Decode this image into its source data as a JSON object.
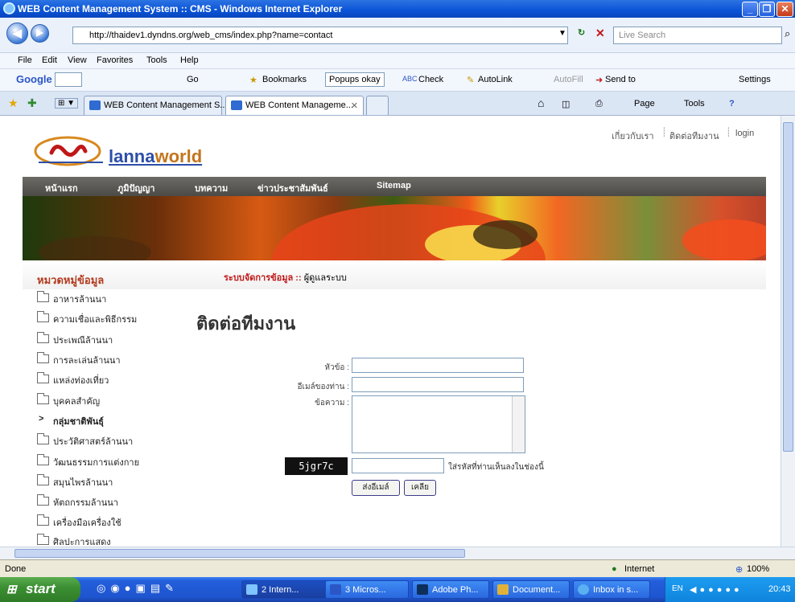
{
  "window": {
    "title": "WEB Content Management System :: CMS - Windows Internet Explorer"
  },
  "browser": {
    "address": "http://thaidev1.dyndns.org/web_cms/index.php?name=contact",
    "search_placeholder": "Live Search",
    "menu": [
      "File",
      "Edit",
      "View",
      "Favorites",
      "Tools",
      "Help"
    ],
    "google_toolbar": {
      "brand": "Google",
      "go": "Go",
      "bookmarks": "Bookmarks",
      "popups": "Popups okay",
      "check": "Check",
      "autolink": "AutoLink",
      "autofill": "AutoFill",
      "sendto": "Send to",
      "settings": "Settings"
    },
    "tabs": [
      {
        "label": "WEB Content Management S..."
      },
      {
        "label": "WEB Content Manageme..."
      }
    ],
    "commands": {
      "page": "Page",
      "tools": "Tools"
    }
  },
  "site": {
    "top_links": [
      "เกี่ยวกับเรา",
      "ติดต่อทีมงาน",
      "login"
    ],
    "logo": {
      "part1": "lanna",
      "part2": "world"
    },
    "nav": [
      "หน้าแรก",
      "ภูมิปัญญา",
      "บทความ",
      "ข่าวประชาสัมพันธ์",
      "Sitemap"
    ],
    "sidebar": {
      "title": "หมวดหมู่ข้อมูล",
      "items": [
        "อาหารล้านนา",
        "ความเชื่อและพิธีกรรม",
        "ประเพณีล้านนา",
        "การละเล่นล้านนา",
        "แหล่งท่องเที่ยว",
        "บุคคลสำคัญ",
        "กลุ่มชาติพันธุ์",
        "ประวัติศาสตร์ล้านนา",
        "วัฒนธรรมการแต่งกาย",
        "สมุนไพรล้านนา",
        "หัตถกรรมล้านนา",
        "เครื่องมือเครื่องใช้",
        "ศิลปะการแสดง"
      ]
    },
    "breadcrumb": {
      "section": "ระบบจัดการข้อมูล ::",
      "current": "ผู้ดูแลระบบ"
    },
    "heading": "ติดต่อทีมงาน",
    "form": {
      "subject_label": "หัวข้อ :",
      "email_label": "อีเมล์ของท่าน :",
      "message_label": "ข้อความ :",
      "captcha_code": "5jgr7c",
      "captcha_hint": "ใส่รหัสที่ท่านเห็นลงในช่องนี้",
      "send_button": "ส่งอีเมล์",
      "clear_button": "เคลีย"
    }
  },
  "status": {
    "text": "Done",
    "zone": "Internet",
    "zoom": "100%"
  },
  "taskbar": {
    "start": "start",
    "tasks": [
      "2 Intern...",
      "3 Micros...",
      "Adobe Ph...",
      "Document...",
      "Inbox in s..."
    ],
    "lang": "EN",
    "clock": "20:43"
  }
}
